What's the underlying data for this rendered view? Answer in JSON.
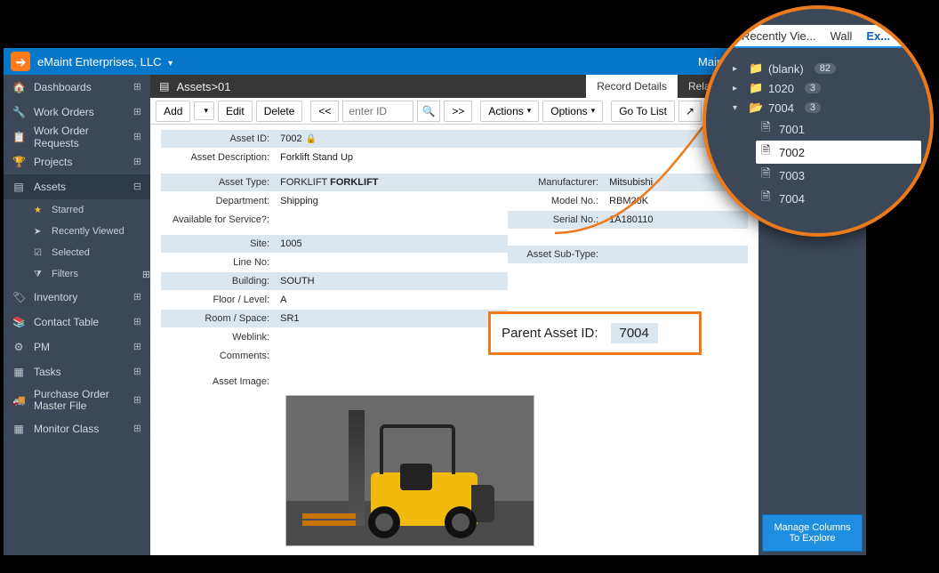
{
  "header": {
    "org_name": "eMaint Enterprises, LLC",
    "main_menu": "Main Menu",
    "icons": [
      "user-icon",
      "pin-icon",
      "close-cross-icon",
      "export-icon"
    ]
  },
  "sidebar": {
    "items": [
      {
        "icon": "home",
        "label": "Dashboards"
      },
      {
        "icon": "wrench",
        "label": "Work Orders"
      },
      {
        "icon": "clipboard",
        "label": "Work Order Requests"
      },
      {
        "icon": "trophy",
        "label": "Projects"
      },
      {
        "icon": "list",
        "label": "Assets",
        "active": true,
        "minus": true
      },
      {
        "icon": "tag",
        "label": "Inventory"
      },
      {
        "icon": "book",
        "label": "Contact Table"
      },
      {
        "icon": "gears",
        "label": "PM"
      },
      {
        "icon": "tasks",
        "label": "Tasks"
      },
      {
        "icon": "truck",
        "label": "Purchase Order Master File"
      },
      {
        "icon": "grid",
        "label": "Monitor Class"
      }
    ],
    "assets_sub": [
      {
        "icon": "star",
        "label": "Starred",
        "star": true
      },
      {
        "icon": "send",
        "label": "Recently Viewed"
      },
      {
        "icon": "check",
        "label": "Selected"
      },
      {
        "icon": "filter",
        "label": "Filters",
        "plus": true
      }
    ]
  },
  "breadcrumb": "Assets>01",
  "tabs": [
    {
      "label": "Record Details",
      "active": true
    },
    {
      "label": "Related Ta",
      "active": false
    }
  ],
  "toolbar": {
    "add": "Add",
    "edit": "Edit",
    "delete": "Delete",
    "prev": "<<",
    "enter_id_placeholder": "enter ID",
    "next": ">>",
    "actions": "Actions",
    "options": "Options",
    "goto": "Go To List"
  },
  "form": {
    "asset_id_label": "Asset ID:",
    "asset_id": "7002",
    "asset_desc_label": "Asset Description:",
    "asset_desc": "Forklift Stand Up",
    "asset_type_label": "Asset Type:",
    "asset_type_prefix": "FORKLIFT ",
    "asset_type_bold": "FORKLIFT",
    "dept_label": "Department:",
    "dept": "Shipping",
    "avail_label": "Available for Service?:",
    "avail": "",
    "site_label": "Site:",
    "site": "1005",
    "line_label": "Line No:",
    "line": "",
    "building_label": "Building:",
    "building": "SOUTH",
    "floor_label": "Floor / Level:",
    "floor": "A",
    "room_label": "Room / Space:",
    "room": "SR1",
    "weblink_label": "Weblink:",
    "weblink": "",
    "comments_label": "Comments:",
    "comments": "",
    "asset_image_label": "Asset Image:",
    "manufacturer_label": "Manufacturer:",
    "manufacturer": "Mitsubishi",
    "model_label": "Model No.:",
    "model": "RBM20K",
    "serial_label": "Serial No.:",
    "serial": "1A180110",
    "subtype_label": "Asset Sub-Type:",
    "subtype": "",
    "parent_label": "Parent Asset ID:",
    "parent": "7004"
  },
  "right_panel": {
    "manage": "Manage Columns To Explore"
  },
  "magnifier": {
    "tabs": [
      "Recently Vie...",
      "Wall",
      "Ex..."
    ],
    "tree": [
      {
        "expand": "right",
        "folder": true,
        "label": "(blank)",
        "count": "82"
      },
      {
        "expand": "right",
        "folder": true,
        "label": "1020",
        "count": "3"
      },
      {
        "expand": "down",
        "folder_open": true,
        "label": "7004",
        "count": "3",
        "children": [
          {
            "label": "7001"
          },
          {
            "label": "7002",
            "selected": true
          },
          {
            "label": "7003"
          },
          {
            "label": "7004"
          }
        ]
      }
    ]
  }
}
